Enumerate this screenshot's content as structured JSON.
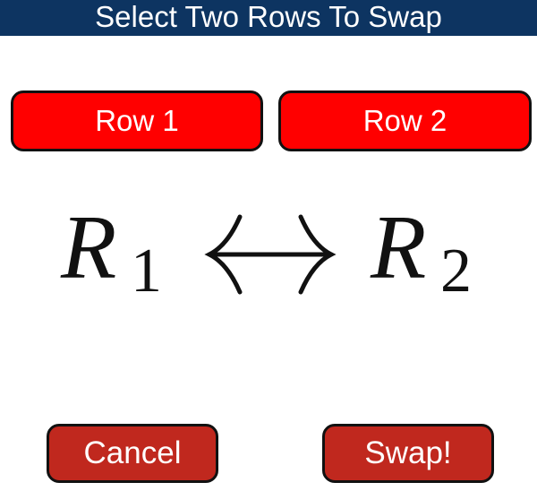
{
  "header": {
    "title": "Select Two Rows To Swap"
  },
  "row_buttons": [
    {
      "label": "Row 1"
    },
    {
      "label": "Row 2"
    }
  ],
  "formula": {
    "left_symbol": "R",
    "left_subscript": "1",
    "operator": "↔",
    "right_symbol": "R",
    "right_subscript": "2"
  },
  "actions": {
    "cancel_label": "Cancel",
    "swap_label": "Swap!"
  },
  "colors": {
    "header_bg": "#0d3461",
    "row_button_bg": "#ff0000",
    "action_button_bg": "#c0281e",
    "text_on_button": "#ffffff"
  }
}
